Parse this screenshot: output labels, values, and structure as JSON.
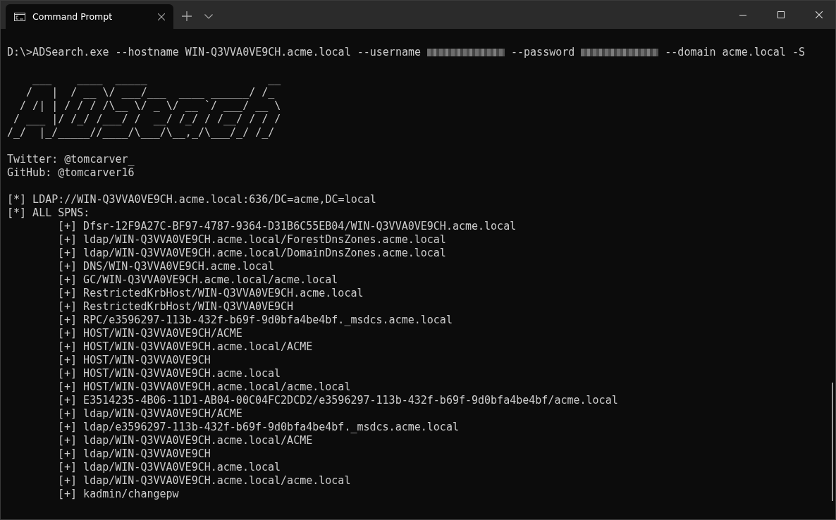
{
  "window": {
    "tab_title": "Command Prompt"
  },
  "command": [
    {
      "kind": "text",
      "text": "D:\\>ADSearch.exe --hostname WIN-Q3VVA0VE9CH.acme.local --username"
    },
    {
      "kind": "redacted"
    },
    {
      "kind": "text",
      "text": "--password"
    },
    {
      "kind": "redacted"
    },
    {
      "kind": "text",
      "text": "--domain acme.local -S"
    }
  ],
  "banner_lines": [
    "    ___    ____  _____                   __",
    "   /   |  / __ \\/ ___/___  ____ ______/ /_",
    "  / /| | / / / /\\__ \\/ _ \\/ __ `/ ___/ __ \\",
    " / ___ |/ /_/ /___/ /  __/ /_/ / /__/ / / /",
    "/_/  |_/_____//____/\\___/\\__,_/\\___/_/ /_/"
  ],
  "credits": [
    "Twitter: @tomcarver_",
    "GitHub: @tomcarver16"
  ],
  "output": [
    {
      "kind": "info",
      "text": "[*] LDAP://WIN-Q3VVA0VE9CH.acme.local:636/DC=acme,DC=local"
    },
    {
      "kind": "info",
      "text": "[*] ALL SPNS:"
    },
    {
      "kind": "item",
      "text": "[+] Dfsr-12F9A27C-BF97-4787-9364-D31B6C55EB04/WIN-Q3VVA0VE9CH.acme.local"
    },
    {
      "kind": "item",
      "text": "[+] ldap/WIN-Q3VVA0VE9CH.acme.local/ForestDnsZones.acme.local"
    },
    {
      "kind": "item",
      "text": "[+] ldap/WIN-Q3VVA0VE9CH.acme.local/DomainDnsZones.acme.local"
    },
    {
      "kind": "item",
      "text": "[+] DNS/WIN-Q3VVA0VE9CH.acme.local"
    },
    {
      "kind": "item",
      "text": "[+] GC/WIN-Q3VVA0VE9CH.acme.local/acme.local"
    },
    {
      "kind": "item",
      "text": "[+] RestrictedKrbHost/WIN-Q3VVA0VE9CH.acme.local"
    },
    {
      "kind": "item",
      "text": "[+] RestrictedKrbHost/WIN-Q3VVA0VE9CH"
    },
    {
      "kind": "item",
      "text": "[+] RPC/e3596297-113b-432f-b69f-9d0bfa4be4bf._msdcs.acme.local"
    },
    {
      "kind": "item",
      "text": "[+] HOST/WIN-Q3VVA0VE9CH/ACME"
    },
    {
      "kind": "item",
      "text": "[+] HOST/WIN-Q3VVA0VE9CH.acme.local/ACME"
    },
    {
      "kind": "item",
      "text": "[+] HOST/WIN-Q3VVA0VE9CH"
    },
    {
      "kind": "item",
      "text": "[+] HOST/WIN-Q3VVA0VE9CH.acme.local"
    },
    {
      "kind": "item",
      "text": "[+] HOST/WIN-Q3VVA0VE9CH.acme.local/acme.local"
    },
    {
      "kind": "item",
      "text": "[+] E3514235-4B06-11D1-AB04-00C04FC2DCD2/e3596297-113b-432f-b69f-9d0bfa4be4bf/acme.local"
    },
    {
      "kind": "item",
      "text": "[+] ldap/WIN-Q3VVA0VE9CH/ACME"
    },
    {
      "kind": "item",
      "text": "[+] ldap/e3596297-113b-432f-b69f-9d0bfa4be4bf._msdcs.acme.local"
    },
    {
      "kind": "item",
      "text": "[+] ldap/WIN-Q3VVA0VE9CH.acme.local/ACME"
    },
    {
      "kind": "item",
      "text": "[+] ldap/WIN-Q3VVA0VE9CH"
    },
    {
      "kind": "item",
      "text": "[+] ldap/WIN-Q3VVA0VE9CH.acme.local"
    },
    {
      "kind": "item",
      "text": "[+] ldap/WIN-Q3VVA0VE9CH.acme.local/acme.local"
    },
    {
      "kind": "item",
      "text": "[+] kadmin/changepw"
    }
  ]
}
